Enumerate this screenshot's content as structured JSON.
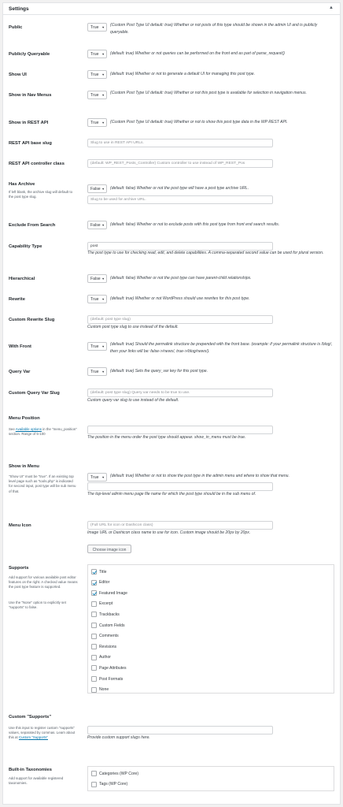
{
  "panel": {
    "title": "Settings",
    "toggle_icon": "caret-up-icon"
  },
  "select_caret": "▼",
  "fields": {
    "public": {
      "label": "Public",
      "value": "True",
      "desc": "(Custom Post Type UI default: true) Whether or not posts of this type should be shown in the admin UI and is publicly queryable."
    },
    "publicly_queryable": {
      "label": "Publicly Queryable",
      "value": "True",
      "desc": "(default: true) Whether or not queries can be performed on the front end as part of parse_request()"
    },
    "show_ui": {
      "label": "Show UI",
      "value": "True",
      "desc": "(default: true) Whether or not to generate a default UI for managing this post type."
    },
    "show_in_nav_menus": {
      "label": "Show in Nav Menus",
      "value": "True",
      "desc": "(Custom Post Type UI default: true) Whether or not this post type is available for selection in navigation menus."
    },
    "show_in_rest": {
      "label": "Show in REST API",
      "value": "True",
      "desc": "(Custom Post Type UI default: true) Whether or not to show this post type data in the WP REST API."
    },
    "rest_base": {
      "label": "REST API base slug",
      "placeholder": "Slug to use in REST API URLs."
    },
    "rest_controller_class": {
      "label": "REST API controller class",
      "placeholder": "(default: WP_REST_Posts_Controller) Custom controller to use instead of WP_REST_Pos"
    },
    "has_archive": {
      "label": "Has Archive",
      "help": "If left blank, the archive slug will default to the post type slug.",
      "value": "False",
      "desc": "(default: false) Whether or not the post type will have a post type archive URL.",
      "placeholder": "Slug to be used for archive URL."
    },
    "exclude_from_search": {
      "label": "Exclude From Search",
      "value": "False",
      "desc": "(default: false) Whether or not to exclude posts with this post type from front end search results."
    },
    "capability_type": {
      "label": "Capability Type",
      "value": "post",
      "desc": "The post type to use for checking read, edit, and delete capabilities. A comma-separated second value can be used for plural version."
    },
    "hierarchical": {
      "label": "Hierarchical",
      "value": "False",
      "desc": "(default: false) Whether or not the post type can have parent-child relationships."
    },
    "rewrite": {
      "label": "Rewrite",
      "value": "True",
      "desc": "(default: true) Whether or not WordPress should use rewrites for this post type."
    },
    "rewrite_slug": {
      "label": "Custom Rewrite Slug",
      "placeholder": "(default: post type slug)",
      "desc": "Custom post type slug to use instead of the default."
    },
    "with_front": {
      "label": "With Front",
      "value": "True",
      "desc": "(default: true) Should the permalink structure be prepended with the front base. (example: if your permalink structure is /blog/, then your links will be: false->/news/, true->/blog/news/)."
    },
    "query_var": {
      "label": "Query Var",
      "value": "True",
      "desc": "(default: true) Sets the query_var key for this post type."
    },
    "query_var_slug": {
      "label": "Custom Query Var Slug",
      "placeholder": "(default: post type slug) Query var needs to be true to use.",
      "desc": "Custom query var slug to use instead of the default."
    },
    "menu_position": {
      "label": "Menu Position",
      "help_link": "Available options",
      "help_prefix": "See ",
      "help_suffix": " in the \"menu_position\" section. Range of 5-100",
      "desc": "The position in the menu order the post type should appear. show_in_menu must be true."
    },
    "show_in_menu": {
      "label": "Show in Menu",
      "help": "\"Show UI\" must be \"true\". If an existing top level page such as \"tools.php\" is indicated for second input, post type will be sub menu of that.",
      "value": "True",
      "desc": "(default: true) Whether or not to show the post type in the admin menu and where to show that menu.",
      "desc2": "The top-level admin menu page file name for which the post type should be in the sub menu of."
    },
    "menu_icon": {
      "label": "Menu Icon",
      "placeholder": "(Full URL for icon or Dashicon class)",
      "desc": "Image URL or Dashicon class name to use for icon. Custom image should be 20px by 20px.",
      "button": "Choose image icon"
    },
    "supports": {
      "label": "Supports",
      "help1": "Add support for various available post editor features on the right. A checked value means the post type feature is supported.",
      "help2": "Use the \"None\" option to explicitly set \"supports\" to false.",
      "options": [
        {
          "label": "Title",
          "checked": true
        },
        {
          "label": "Editor",
          "checked": true
        },
        {
          "label": "Featured Image",
          "checked": true
        },
        {
          "label": "Excerpt",
          "checked": false
        },
        {
          "label": "Trackbacks",
          "checked": false
        },
        {
          "label": "Custom Fields",
          "checked": false
        },
        {
          "label": "Comments",
          "checked": false
        },
        {
          "label": "Revisions",
          "checked": false
        },
        {
          "label": "Author",
          "checked": false
        },
        {
          "label": "Page Attributes",
          "checked": false
        },
        {
          "label": "Post Formats",
          "checked": false
        },
        {
          "label": "None",
          "checked": false
        }
      ]
    },
    "custom_supports": {
      "label": "Custom \"Supports\"",
      "help_prefix": "Use this input to register custom \"supports\" values, separated by commas. Learn about this at ",
      "help_link": "Custom \"Supports\"",
      "desc": "Provide custom support slugs here."
    },
    "taxonomies": {
      "label": "Built-in Taxonomies",
      "help": "Add support for available registered taxonomies.",
      "options": [
        {
          "label": "Categories (WP Core)",
          "checked": false
        },
        {
          "label": "Tags (WP Core)",
          "checked": false
        }
      ]
    }
  }
}
